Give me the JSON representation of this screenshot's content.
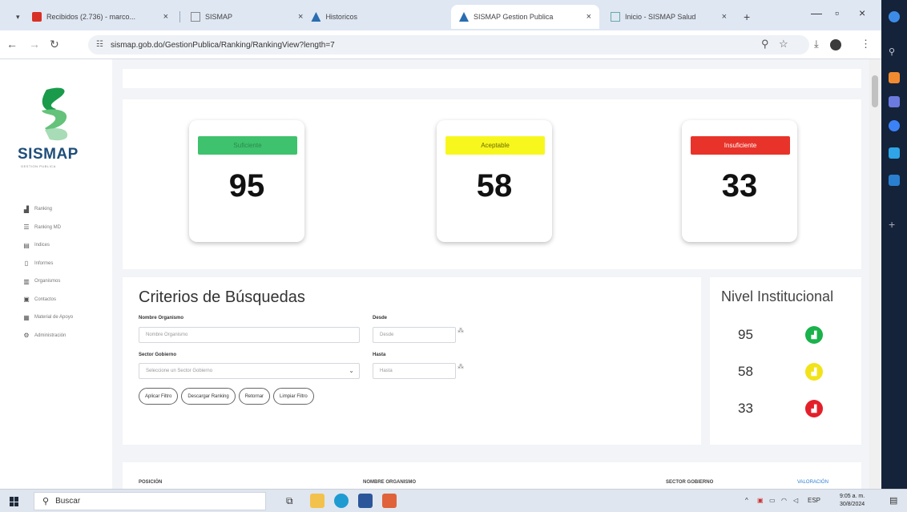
{
  "browser": {
    "tabs": [
      {
        "label": "Recibidos (2.736) - marco...",
        "active": false
      },
      {
        "label": "SISMAP",
        "active": false
      },
      {
        "label": "Historicos",
        "active": false
      },
      {
        "label": "SISMAP Gestion Publica",
        "active": true
      },
      {
        "label": "Inicio - SISMAP Salud",
        "active": false
      }
    ],
    "new_tab": "+",
    "url": "sismap.gob.do/GestionPublica/Ranking/RankingView?length=7"
  },
  "sidebar": {
    "logo_text": "SISMAP",
    "logo_sub": "GESTION PUBLICA",
    "items": [
      {
        "label": "Ranking",
        "icon": "bar-chart-icon"
      },
      {
        "label": "Ranking MD",
        "icon": "list-icon"
      },
      {
        "label": "Indices",
        "icon": "table-icon"
      },
      {
        "label": "Informes",
        "icon": "document-icon"
      },
      {
        "label": "Organismos",
        "icon": "building-icon"
      },
      {
        "label": "Contactos",
        "icon": "contacts-icon"
      },
      {
        "label": "Material de Apoyo",
        "icon": "book-icon"
      },
      {
        "label": "Administración",
        "icon": "gears-icon"
      }
    ]
  },
  "cards": [
    {
      "badge": "Suficiente",
      "value": "95",
      "color": "#3ec26d",
      "text_color": "#2d8a4e"
    },
    {
      "badge": "Aceptable",
      "value": "58",
      "color": "#f7f71e",
      "text_color": "#6b6b00"
    },
    {
      "badge": "Insuficiente",
      "value": "33",
      "color": "#e8332a",
      "text_color": "#ffffff"
    }
  ],
  "criterios": {
    "title": "Criterios de Búsquedas",
    "organismo_label": "Nombre Organismo",
    "organismo_placeholder": "Nombre Organismo",
    "desde_label": "Desde",
    "desde_placeholder": "Desde",
    "sector_label": "Sector Gobierno",
    "sector_placeholder": "Seleccione un Sector Gobierno",
    "hasta_label": "Hasta",
    "hasta_placeholder": "Hasta",
    "buttons": [
      "Aplicar Filtro",
      "Descargar Ranking",
      "Retornar",
      "Limpiar Filtro"
    ]
  },
  "nivel": {
    "title": "Nivel Institucional",
    "rows": [
      {
        "value": "95",
        "color": "#19b24b"
      },
      {
        "value": "58",
        "color": "#f2e21a"
      },
      {
        "value": "33",
        "color": "#e3202a"
      }
    ]
  },
  "table": {
    "headers": [
      "POSICIÓN",
      "NOMBRE ORGANISMO",
      "SECTOR GOBIERNO",
      "VALORACIÓN"
    ]
  },
  "taskbar": {
    "search_placeholder": "Buscar",
    "lang": "ESP",
    "time": "9:05 a. m.",
    "date": "30/8/2024"
  }
}
